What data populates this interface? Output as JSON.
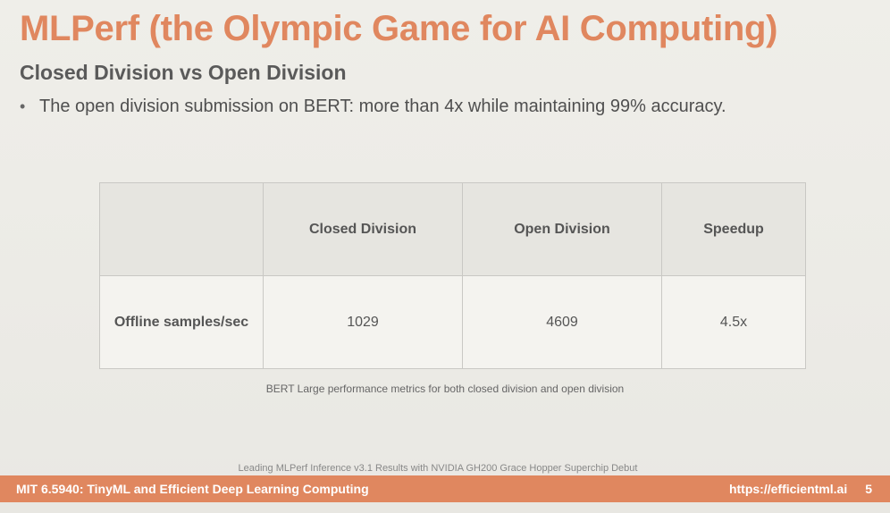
{
  "slide": {
    "title": "MLPerf (the Olympic Game for AI Computing)",
    "subtitle": "Closed Division vs Open Division",
    "bullet_symbol": "•",
    "bullet_text": "The open division submission on BERT: more than 4x while maintaining 99% accuracy."
  },
  "table": {
    "headers": [
      "",
      "Closed Division",
      "Open Division",
      "Speedup"
    ],
    "rows": [
      {
        "label": "Offline samples/sec",
        "closed": "1029",
        "open": "4609",
        "speedup": "4.5x"
      }
    ],
    "caption": "BERT Large performance metrics for both closed division and open division"
  },
  "source_note": "Leading MLPerf Inference v3.1 Results with NVIDIA GH200 Grace Hopper Superchip Debut",
  "footer": {
    "course": "MIT 6.5940: TinyML and Efficient Deep Learning Computing",
    "url": "https://efficientml.ai",
    "page_number": "5"
  },
  "colors": {
    "accent": "#e0875f",
    "heading_text": "#5a5a5a",
    "body_text": "#4f4f4f"
  }
}
